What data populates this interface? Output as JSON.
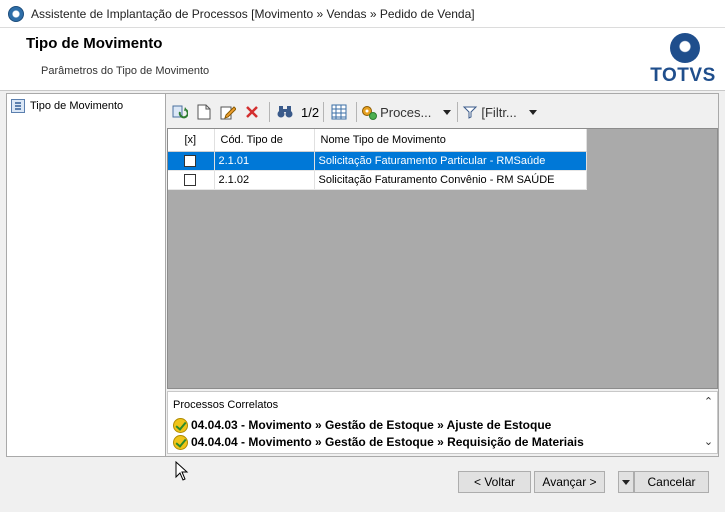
{
  "window": {
    "title": "Assistente de Implantação de Processos [Movimento » Vendas » Pedido de Venda]"
  },
  "header": {
    "title": "Tipo de Movimento",
    "subtitle": "Parâmetros do Tipo de Movimento",
    "logo_text": "TOTVS"
  },
  "tree": {
    "items": [
      {
        "label": "Tipo de Movimento",
        "icon": "list-icon"
      }
    ]
  },
  "toolbar": {
    "record_counter": "1/2",
    "process_label": "Proces...",
    "filter_label": "[Filtr..."
  },
  "grid": {
    "columns": [
      "[x]",
      "Cód. Tipo de",
      "Nome Tipo de Movimento"
    ],
    "rows": [
      {
        "checked": false,
        "code": "2.1.01",
        "name": "Solicitação Faturamento Particular - RMSaúde",
        "selected": true
      },
      {
        "checked": false,
        "code": "2.1.02",
        "name": "Solicitação Faturamento Convênio - RM SAÚDE",
        "selected": false
      }
    ]
  },
  "correlatos": {
    "title": "Processos Correlatos",
    "items": [
      "04.04.03 - Movimento » Gestão de Estoque » Ajuste de Estoque",
      "04.04.04 - Movimento » Gestão de Estoque » Requisição de Materiais"
    ]
  },
  "footer": {
    "back_label": "< Voltar",
    "next_label": "Avançar >",
    "cancel_label": "Cancelar"
  },
  "colors": {
    "selection": "#0078d7",
    "brand": "#1f4e8c",
    "grid_background": "#aaaaaa"
  }
}
